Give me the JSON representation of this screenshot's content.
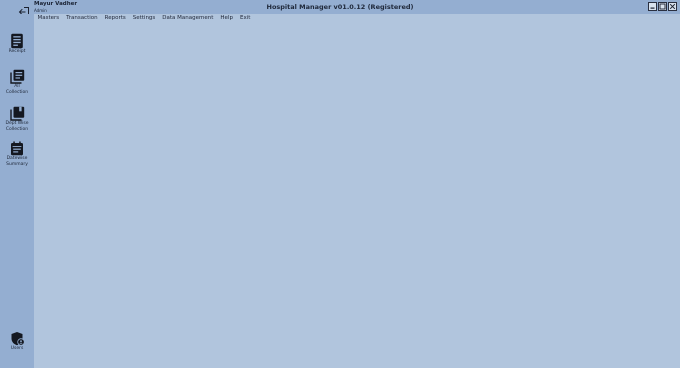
{
  "app": {
    "title": "Hospital Manager v01.0.12 (Registered)"
  },
  "user": {
    "name": "Mayur Vadher",
    "role": "Admin"
  },
  "menu": [
    {
      "label": "Masters"
    },
    {
      "label": "Transaction"
    },
    {
      "label": "Reports"
    },
    {
      "label": "Settings"
    },
    {
      "label": "Data Management"
    },
    {
      "label": "Help"
    },
    {
      "label": "Exit"
    }
  ],
  "sidebar": {
    "items": [
      {
        "label": "Receipt",
        "icon": "receipt-icon"
      },
      {
        "label": "All\nCollection",
        "icon": "list-document-icon"
      },
      {
        "label": "Dept Wise\nCollection",
        "icon": "stacked-documents-icon"
      },
      {
        "label": "Datewise\nSummary",
        "icon": "calendar-icon"
      }
    ],
    "users": {
      "label": "Users",
      "icon": "user-settings-icon"
    }
  },
  "colors": {
    "background": "#b1c5dd",
    "chrome": "#94aed1",
    "icon": "#141821"
  }
}
